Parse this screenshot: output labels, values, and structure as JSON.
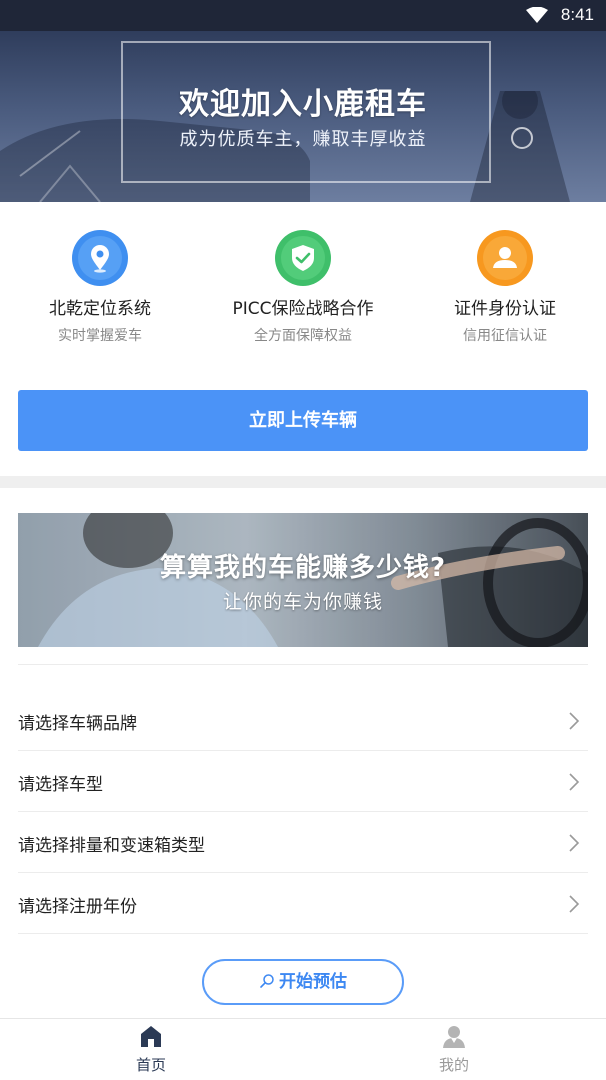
{
  "status_bar": {
    "time": "8:41"
  },
  "hero": {
    "title": "欢迎加入小鹿租车",
    "subtitle": "成为优质车主，赚取丰厚收益"
  },
  "features": [
    {
      "name": "北乾定位系统",
      "desc": "实时掌握爱车",
      "icon": "location-pin-icon",
      "color": "#3f8ff0"
    },
    {
      "name": "PICC保险战略合作",
      "desc": "全方面保障权益",
      "icon": "shield-check-icon",
      "color": "#3fbf6a"
    },
    {
      "name": "证件身份认证",
      "desc": "信用征信认证",
      "icon": "user-id-icon",
      "color": "#f7981f"
    }
  ],
  "upload_button": {
    "label": "立即上传车辆"
  },
  "estimate_banner": {
    "title": "算算我的车能赚多少钱?",
    "subtitle": "让你的车为你赚钱"
  },
  "select_list": [
    {
      "label": "请选择车辆品牌"
    },
    {
      "label": "请选择车型"
    },
    {
      "label": "请选择排量和变速箱类型"
    },
    {
      "label": "请选择注册年份"
    }
  ],
  "start_button": {
    "label": "开始预估"
  },
  "bottom_nav": [
    {
      "label": "首页",
      "icon": "home-icon",
      "active": true
    },
    {
      "label": "我的",
      "icon": "profile-icon",
      "active": false
    }
  ],
  "colors": {
    "primary": "#4b93f7",
    "nav_active": "#2b3a55",
    "nav_inactive": "#9a9a9a"
  }
}
